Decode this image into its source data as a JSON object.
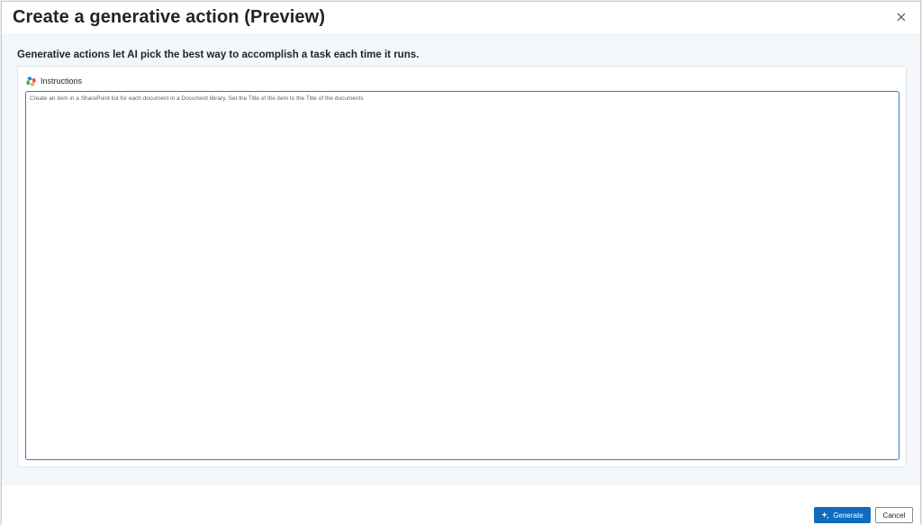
{
  "dialog": {
    "title": "Create a generative action (Preview)",
    "close_icon": "close-icon"
  },
  "main": {
    "description": "Generative actions let AI pick the best way to accomplish a task each time it runs.",
    "instructions": {
      "icon": "copilot-icon",
      "label": "Instructions",
      "value": "Create an item in a SharePoint list for each document in a Document library. Set the Title of the item to the Title of the documents"
    }
  },
  "footer": {
    "generate_label": "Generate",
    "generate_icon": "sparkle-icon",
    "cancel_label": "Cancel"
  },
  "colors": {
    "primary": "#0f6cbd",
    "focus_border": "#2a7fd4",
    "body_background": "#f3f7fa"
  }
}
